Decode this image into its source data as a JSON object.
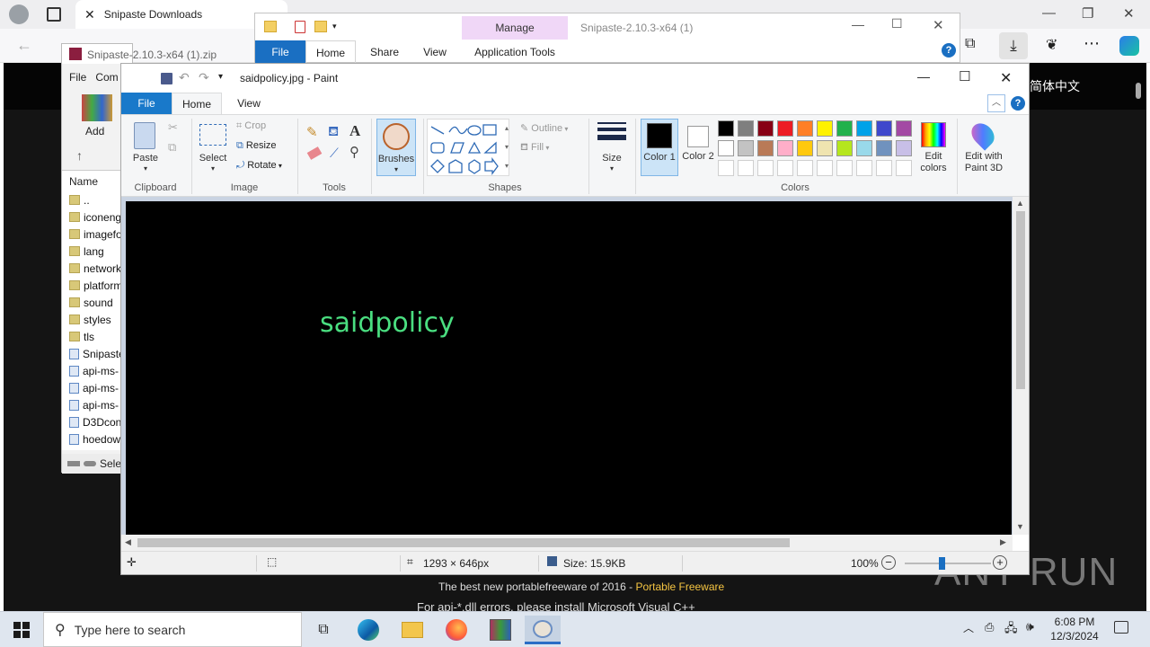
{
  "browser": {
    "tab_title": "Snipaste Downloads",
    "page_lang_text": "简体中文",
    "footer_line1_prefix": "The best new portablefreeware of 2016 - ",
    "footer_line1_link": "Portable Freeware",
    "footer_line2": "For api-*.dll errors, please install Microsoft Visual C++"
  },
  "explorer": {
    "title": "Snipaste-2.10.3-x64 (1)",
    "manage_label": "Manage",
    "tabs": [
      "File",
      "Home",
      "Share",
      "View",
      "Application Tools"
    ]
  },
  "winrar": {
    "title": "Snipaste-2.10.3-x64 (1).zip",
    "menu": [
      "File",
      "Com"
    ],
    "add_label": "Add",
    "column_name": "Name",
    "files": [
      "..",
      "iconeng",
      "imagefo",
      "lang",
      "network",
      "platform",
      "sound",
      "styles",
      "tls",
      "Snipaste",
      "api-ms-",
      "api-ms-",
      "api-ms-",
      "D3Dcon",
      "hoedow"
    ],
    "status_text": "Sele"
  },
  "paint": {
    "title": "saidpolicy.jpg - Paint",
    "menu_tabs": [
      "File",
      "Home",
      "View"
    ],
    "clipboard": {
      "paste": "Paste",
      "label": "Clipboard"
    },
    "image": {
      "select": "Select",
      "crop": "Crop",
      "resize": "Resize",
      "rotate": "Rotate",
      "label": "Image"
    },
    "tools_label": "Tools",
    "brushes_label": "Brushes",
    "shapes": {
      "outline": "Outline",
      "fill": "Fill",
      "label": "Shapes"
    },
    "size_label": "Size",
    "color1_label": "Color 1",
    "color2_label": "Color 2",
    "colors_label": "Colors",
    "edit_colors_label": "Edit colors",
    "paint3d_label": "Edit with Paint 3D",
    "palette_row1": [
      "#000000",
      "#7f7f7f",
      "#880015",
      "#ed1c24",
      "#ff7f27",
      "#fff200",
      "#22b14c",
      "#00a2e8",
      "#3f48cc",
      "#a349a4"
    ],
    "palette_row2": [
      "#ffffff",
      "#c3c3c3",
      "#b97a57",
      "#ffaec9",
      "#ffc90e",
      "#efe4b0",
      "#b5e61d",
      "#99d9ea",
      "#7092be",
      "#c8bfe7"
    ],
    "canvas_text": "saidpolicy",
    "canvas_text_color": "#4ade80",
    "status": {
      "dimensions": "1293 × 646px",
      "size": "Size: 15.9KB",
      "zoom": "100%"
    }
  },
  "taskbar": {
    "search_placeholder": "Type here to search",
    "time": "6:08 PM",
    "date": "12/3/2024"
  },
  "watermark": "ANY RUN"
}
